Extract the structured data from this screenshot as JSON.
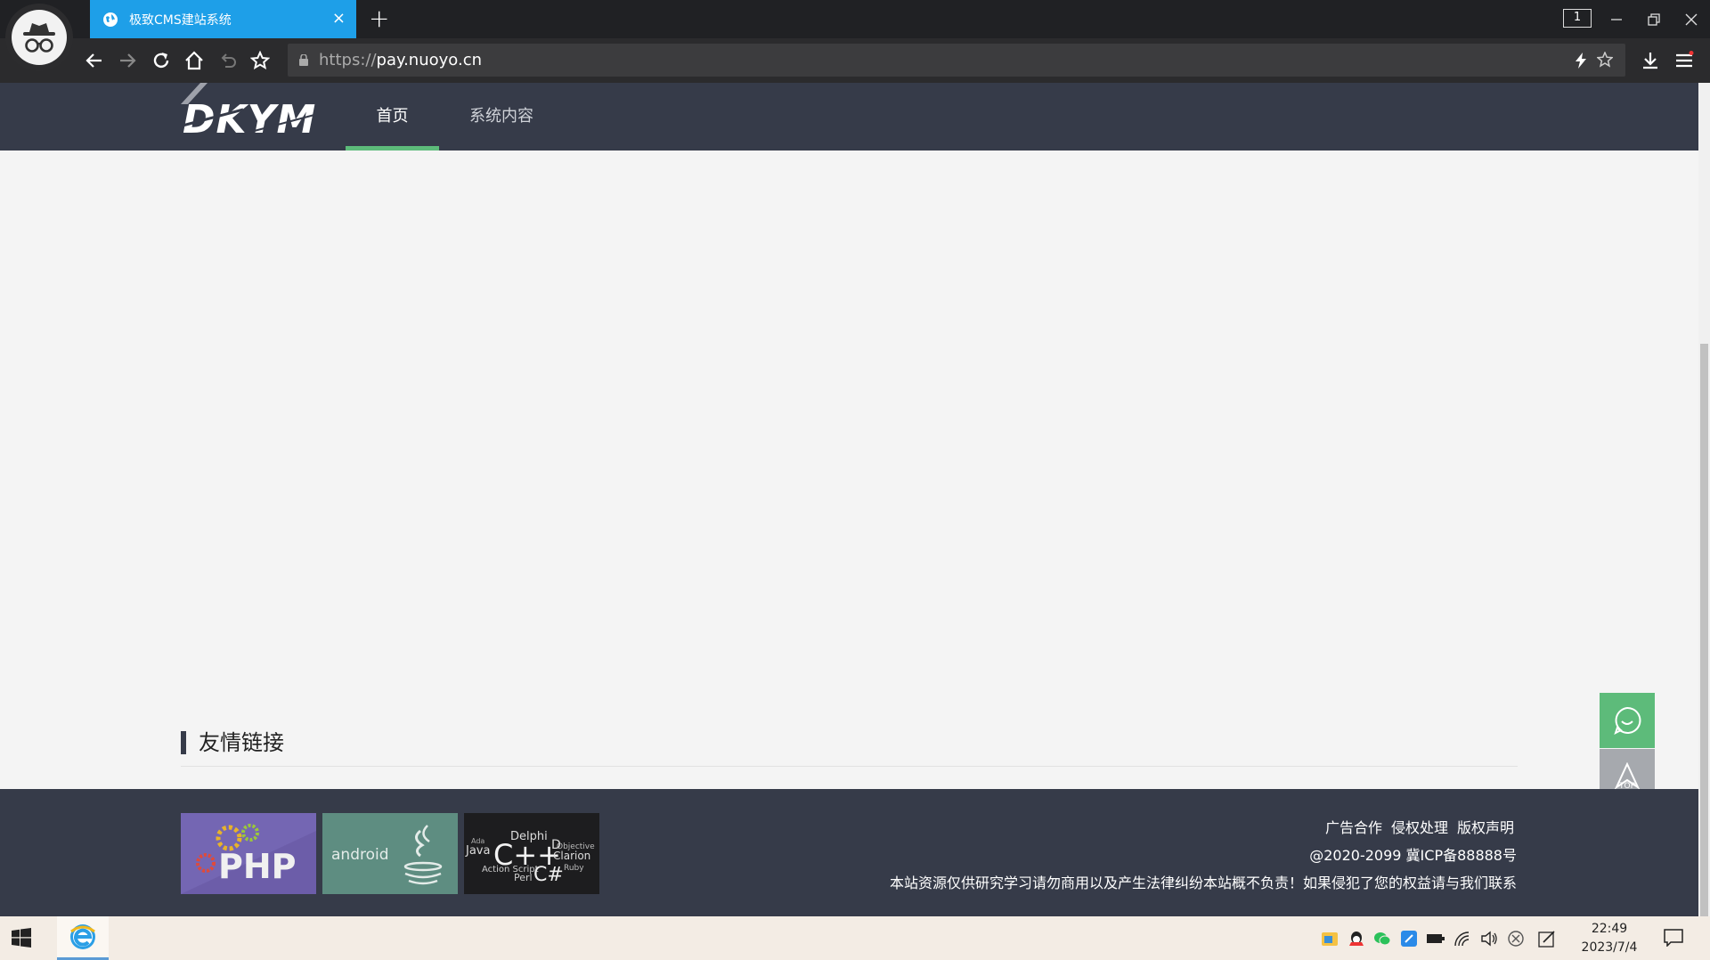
{
  "browser": {
    "tab_title": "极致CMS建站系统",
    "tab_close": "×",
    "new_tab": "+",
    "tab_count": "1",
    "url_proto": "https://",
    "url_host": "pay.nuoyo.cn"
  },
  "site": {
    "logo_text": "DKYM",
    "menu": [
      {
        "label": "首页"
      },
      {
        "label": "系统内容"
      }
    ],
    "links_title": "友情链接",
    "float_top_label": "TOP"
  },
  "footer": {
    "links": [
      "广告合作",
      "侵权处理",
      "版权声明"
    ],
    "copyright": "@2020-2099 冀ICP备88888号",
    "notice": "本站资源仅供研究学习请勿商用以及产生法律纠纷本站概不负责！如果侵犯了您的权益请与我们联系",
    "friend_images": [
      {
        "label": "PHP"
      },
      {
        "label": "android"
      },
      {
        "label": "C++",
        "words": [
          "Delphi",
          "Java",
          "Objective",
          "Clarion",
          "Action Script",
          "C#",
          "Perl",
          "Ruby",
          "Ada",
          "D"
        ]
      }
    ]
  },
  "taskbar": {
    "time": "22:49",
    "date": "2023/7/4"
  },
  "colors": {
    "tab_active": "#1e9fe8",
    "site_header": "#363b49",
    "accent_green": "#5dbb7a",
    "float_gray": "#a6a9ae"
  }
}
